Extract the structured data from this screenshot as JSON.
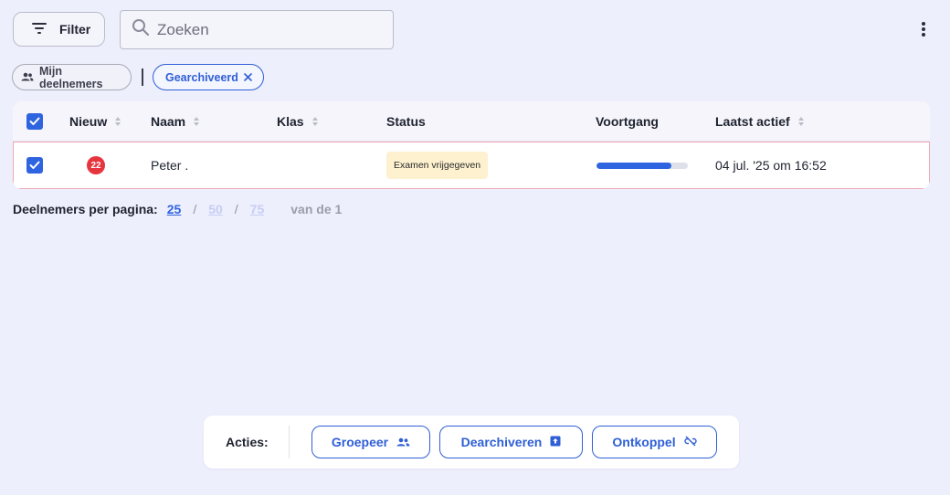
{
  "toolbar": {
    "filter_label": "Filter",
    "search_placeholder": "Zoeken",
    "search_value": ""
  },
  "chips": {
    "mine_label": "Mijn deelnemers",
    "archived_label": "Gearchiveerd"
  },
  "table": {
    "columns": {
      "new": "Nieuw",
      "name": "Naam",
      "class": "Klas",
      "status": "Status",
      "progress": "Voortgang",
      "last_active": "Laatst actief"
    },
    "rows": [
      {
        "selected": true,
        "new_count": "22",
        "name": "Peter .",
        "class": "",
        "status": "Examen vrijgegeven",
        "progress": 0.82,
        "last_active": "04 jul. '25 om 16:52"
      }
    ]
  },
  "pagination": {
    "label": "Deelnemers per pagina:",
    "options": [
      "25",
      "50",
      "75"
    ],
    "selected": "25",
    "of_text": "van de 1"
  },
  "actions": {
    "label": "Acties:",
    "group": "Groepeer",
    "unarchive": "Dearchiveren",
    "unlink": "Ontkoppel"
  },
  "colors": {
    "accent": "#2f64e0",
    "badge": "#e6353f",
    "status_bg": "#fdf1cf",
    "selected_row_border": "#f0a8b3",
    "page_bg": "#eeeffd"
  }
}
